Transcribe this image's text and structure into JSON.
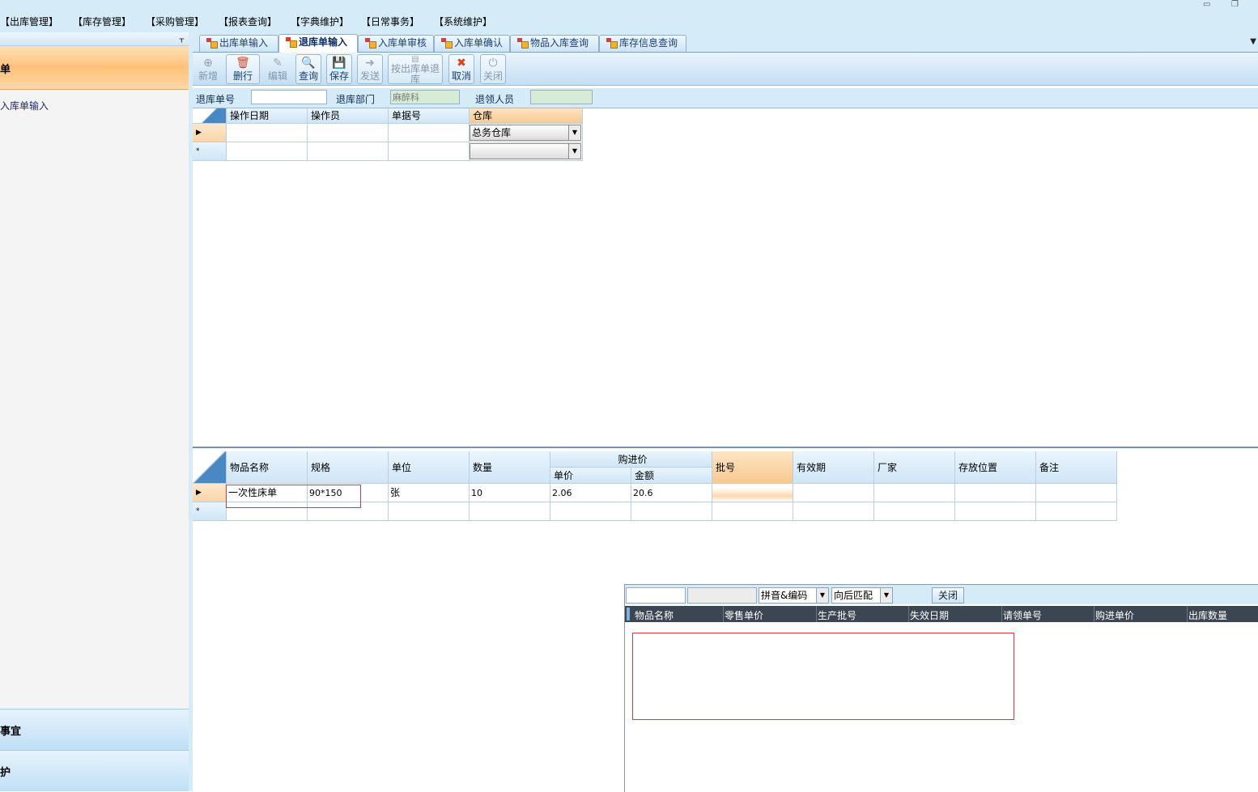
{
  "menubar": {
    "items": [
      "【出库管理】",
      "【库存管理】",
      "【采购管理】",
      "【报表查询】",
      "【字典维护】",
      "【日常事务】",
      "【系统维护】"
    ]
  },
  "sidebar": {
    "active_section": "单",
    "items": [
      "入库单输入"
    ],
    "bottom_sections": [
      "事宜",
      "护"
    ]
  },
  "tabs": {
    "items": [
      "出库单输入",
      "退库单输入",
      "入库单审核",
      "入库单确认",
      "物品入库查询",
      "库存信息查询"
    ],
    "active_index": 1
  },
  "toolbar": {
    "buttons": [
      "新增",
      "删行",
      "编辑",
      "查询",
      "保存",
      "发送",
      "按出库单退库",
      "取消",
      "关闭"
    ]
  },
  "form": {
    "return_no_label": "退库单号",
    "return_no_value": "",
    "dept_label": "退库部门",
    "dept_value": "麻醉科",
    "person_label": "退领人员",
    "person_value": ""
  },
  "master_grid": {
    "columns": [
      "操作日期",
      "操作员",
      "单据号",
      "仓库"
    ],
    "rows": [
      {
        "date": "",
        "operator": "",
        "doc_no": "",
        "warehouse": "总务仓库"
      }
    ],
    "new_row_marker": "*"
  },
  "detail_grid": {
    "columns": [
      "物品名称",
      "规格",
      "单位",
      "数量",
      "购进价",
      "单价",
      "金额",
      "批号",
      "有效期",
      "厂家",
      "存放位置",
      "备注"
    ],
    "rows": [
      {
        "name": "一次性床单",
        "spec": "90*150",
        "unit": "张",
        "qty": "10",
        "price": "2.06",
        "amount": "20.6",
        "batch": "",
        "expiry": "",
        "maker": "",
        "location": "",
        "note": ""
      }
    ],
    "new_row_marker": "*"
  },
  "popup": {
    "input1": "",
    "input2": "",
    "mode_select": "拼音&编码",
    "match_select": "向后匹配",
    "close_label": "关闭",
    "columns": [
      "物品名称",
      "零售单价",
      "生产批号",
      "失效日期",
      "请领单号",
      "购进单价",
      "出库数量"
    ]
  },
  "colors": {
    "accent": "#d6ebf8",
    "highlight": "#f7c98e",
    "popup_header": "#3b4652",
    "annotation_red": "#d9363e"
  }
}
